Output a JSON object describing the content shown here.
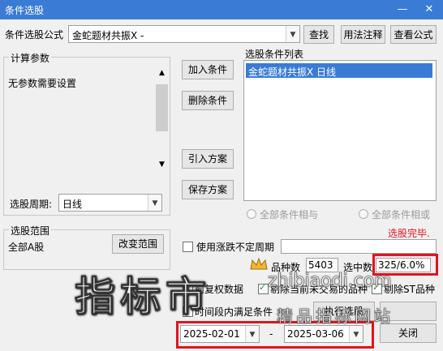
{
  "window": {
    "title": "条件选股"
  },
  "formula": {
    "label": "条件选股公式",
    "value": "金蛇题材共振X  -"
  },
  "buttons": {
    "find": "查找",
    "usage": "用法注释",
    "view_formula": "查看公式",
    "add_condition": "加入条件",
    "delete_condition": "删除条件",
    "import_plan": "引入方案",
    "save_plan": "保存方案",
    "change_range": "改变范围",
    "execute": "执行选股",
    "close": "关闭"
  },
  "params": {
    "title": "计算参数",
    "text": "无参数需要设置"
  },
  "period": {
    "label": "选股周期:",
    "value": "日线"
  },
  "conditions": {
    "title": "选股条件列表",
    "items": [
      "金蛇题材共振X  日线"
    ]
  },
  "logic": {
    "and_label": "全部条件相与",
    "or_label": "全部条件相或"
  },
  "status": {
    "text": "选股完毕."
  },
  "range": {
    "title": "选股范围",
    "value": "全部A股"
  },
  "options": {
    "uncertain_period": "使用涨跌不定周期",
    "pre_rights": "前复权数据",
    "exclude_st": "剔除当前未交易的品种",
    "exclude_st2": "剔除ST品种",
    "time_range": "时间段内满足条件"
  },
  "stats": {
    "count_label": "品种数",
    "count_value": "5403",
    "selected_label": "选中数",
    "selected_value": "325/6.0%"
  },
  "dates": {
    "start": "2025-02-01",
    "separator": "-",
    "end": "2025-03-06"
  },
  "watermark": {
    "big": "指标市",
    "site": "zhibiaodi.com",
    "site_cn": "精品指标网站"
  },
  "colors": {
    "titlebar": "#3a7bd5",
    "selection": "#3a7bd5",
    "highlight": "#e0141e",
    "status": "#e0141e"
  }
}
